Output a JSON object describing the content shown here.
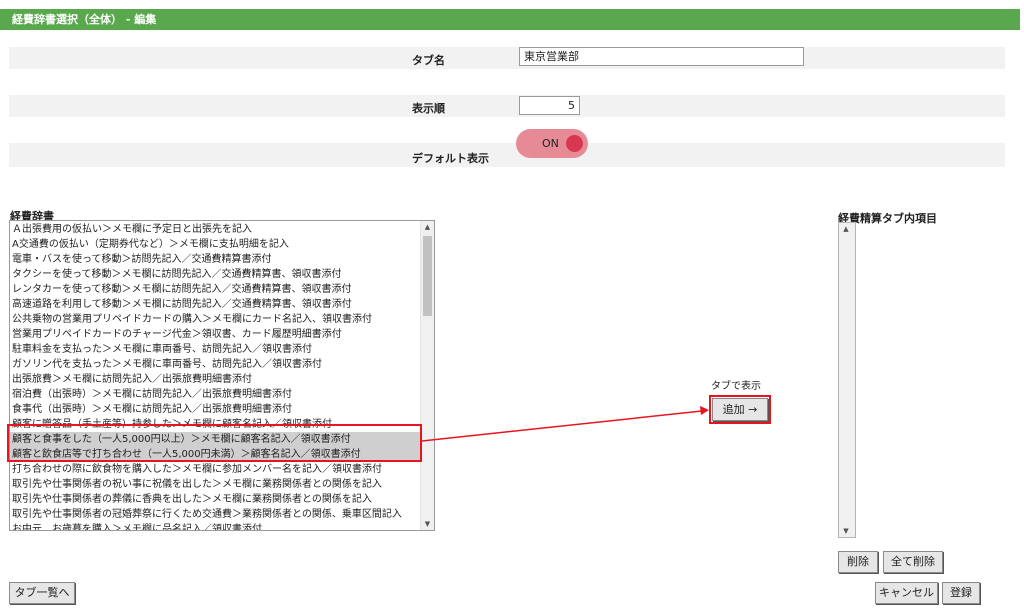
{
  "window": {
    "title": "経費辞書選択（全体） - 編集"
  },
  "form": {
    "tab_name_label": "タブ名",
    "tab_name_value": "東京営業部",
    "order_label": "表示順",
    "order_value": "5",
    "default_label": "デフォルト表示",
    "default_toggle_text": "ON"
  },
  "dictionary": {
    "label": "経費辞書",
    "items": [
      "Ａ出張費用の仮払い＞メモ欄に予定日と出張先を記入",
      "A交通費の仮払い（定期券代など）＞メモ欄に支払明細を記入",
      "電車・バスを使って移動＞訪問先記入／交通費精算書添付",
      "タクシーを使って移動＞メモ欄に訪問先記入／交通費精算書、領収書添付",
      "レンタカーを使って移動＞メモ欄に訪問先記入／交通費精算書、領収書添付",
      "高速道路を利用して移動＞メモ欄に訪問先記入／交通費精算書、領収書添付",
      "公共乗物の営業用プリペイドカードの購入＞メモ欄にカード名記入、領収書添付",
      "営業用プリペイドカードのチャージ代金＞領収書、カード履歴明細書添付",
      "駐車料金を支払った＞メモ欄に車両番号、訪問先記入／領収書添付",
      "ガソリン代を支払った＞メモ欄に車両番号、訪問先記入／領収書添付",
      "出張旅費＞メモ欄に訪問先記入／出張旅費明細書添付",
      "宿泊費（出張時）＞メモ欄に訪問先記入／出張旅費明細書添付",
      "食事代（出張時）＞メモ欄に訪問先記入／出張旅費明細書添付",
      "顧客に贈答品（手土産等）持参した＞メモ欄に顧客名記入／領収書添付",
      "顧客と食事をした（一人5,000円以上）＞メモ欄に顧客名記入／領収書添付",
      "顧客と飲食店等で打ち合わせ（一人5,000円未満）＞顧客名記入／領収書添付",
      "打ち合わせの際に飲食物を購入した＞メモ欄に参加メンバー名を記入／領収書添付",
      "取引先や仕事関係者の祝い事に祝儀を出した＞メモ欄に業務関係者との関係を記入",
      "取引先や仕事関係者の葬儀に香典を出した＞メモ欄に業務関係者との関係を記入",
      "取引先や仕事関係者の冠婚葬祭に行くため交通費＞業務関係者との関係、乗車区間記入",
      "お中元、お歳暮を購入＞メモ欄に品名記入／領収書添付"
    ]
  },
  "middle": {
    "caption": "タブで表示",
    "add_button": "追加 →"
  },
  "right": {
    "label": "経費精算タブ内項目",
    "delete_button": "削除",
    "delete_all_button": "全て削除"
  },
  "footer": {
    "tab_list_button": "タブ一覧へ",
    "cancel_button": "キャンセル",
    "register_button": "登録"
  },
  "colors": {
    "title_bar": "#5aa84e",
    "toggle_bg": "#e68a96",
    "toggle_knob": "#d8374f",
    "annotation": "#e8141f",
    "selection": "#cfcfcf"
  }
}
